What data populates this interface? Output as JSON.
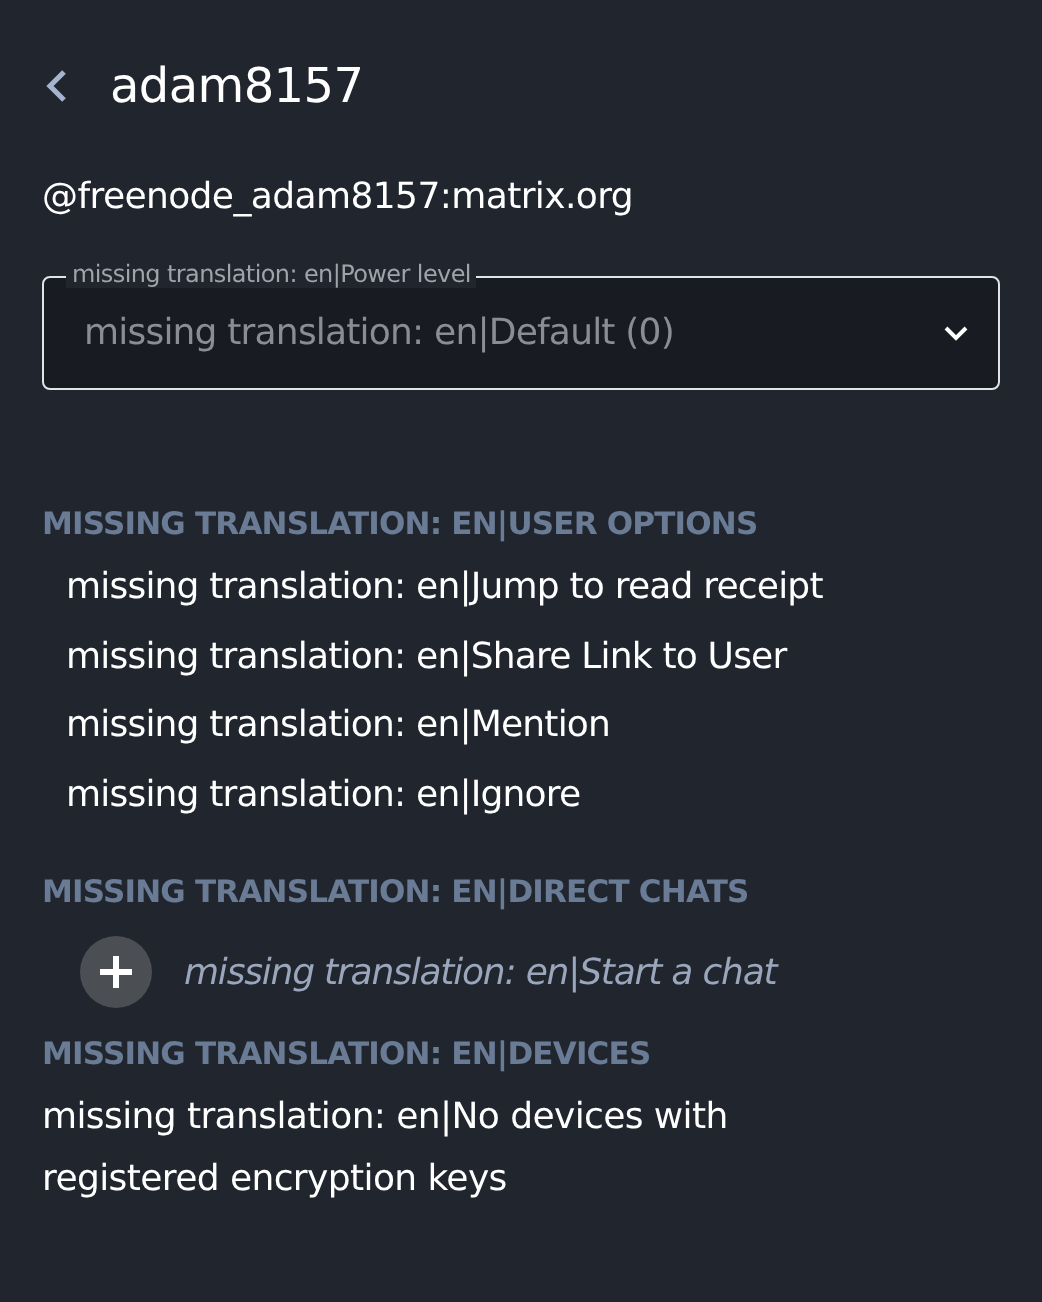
{
  "header": {
    "title": "adam8157"
  },
  "user_id": "@freenode_adam8157:matrix.org",
  "power_level": {
    "label": "missing translation: en|Power level",
    "value": "missing translation: en|Default (0)"
  },
  "user_options": {
    "heading": "MISSING TRANSLATION: EN|USER OPTIONS",
    "items": [
      {
        "label": "missing translation: en|Jump to read receipt"
      },
      {
        "label": "missing translation: en|Share Link to User"
      },
      {
        "label": "missing translation: en|Mention"
      },
      {
        "label": "missing translation: en|Ignore"
      }
    ]
  },
  "direct_chats": {
    "heading": "MISSING TRANSLATION: EN|DIRECT CHATS",
    "start_chat": "missing translation: en|Start a chat"
  },
  "devices": {
    "heading": "MISSING TRANSLATION: EN|DEVICES",
    "message": "missing translation: en|No devices with registered encryption keys"
  }
}
